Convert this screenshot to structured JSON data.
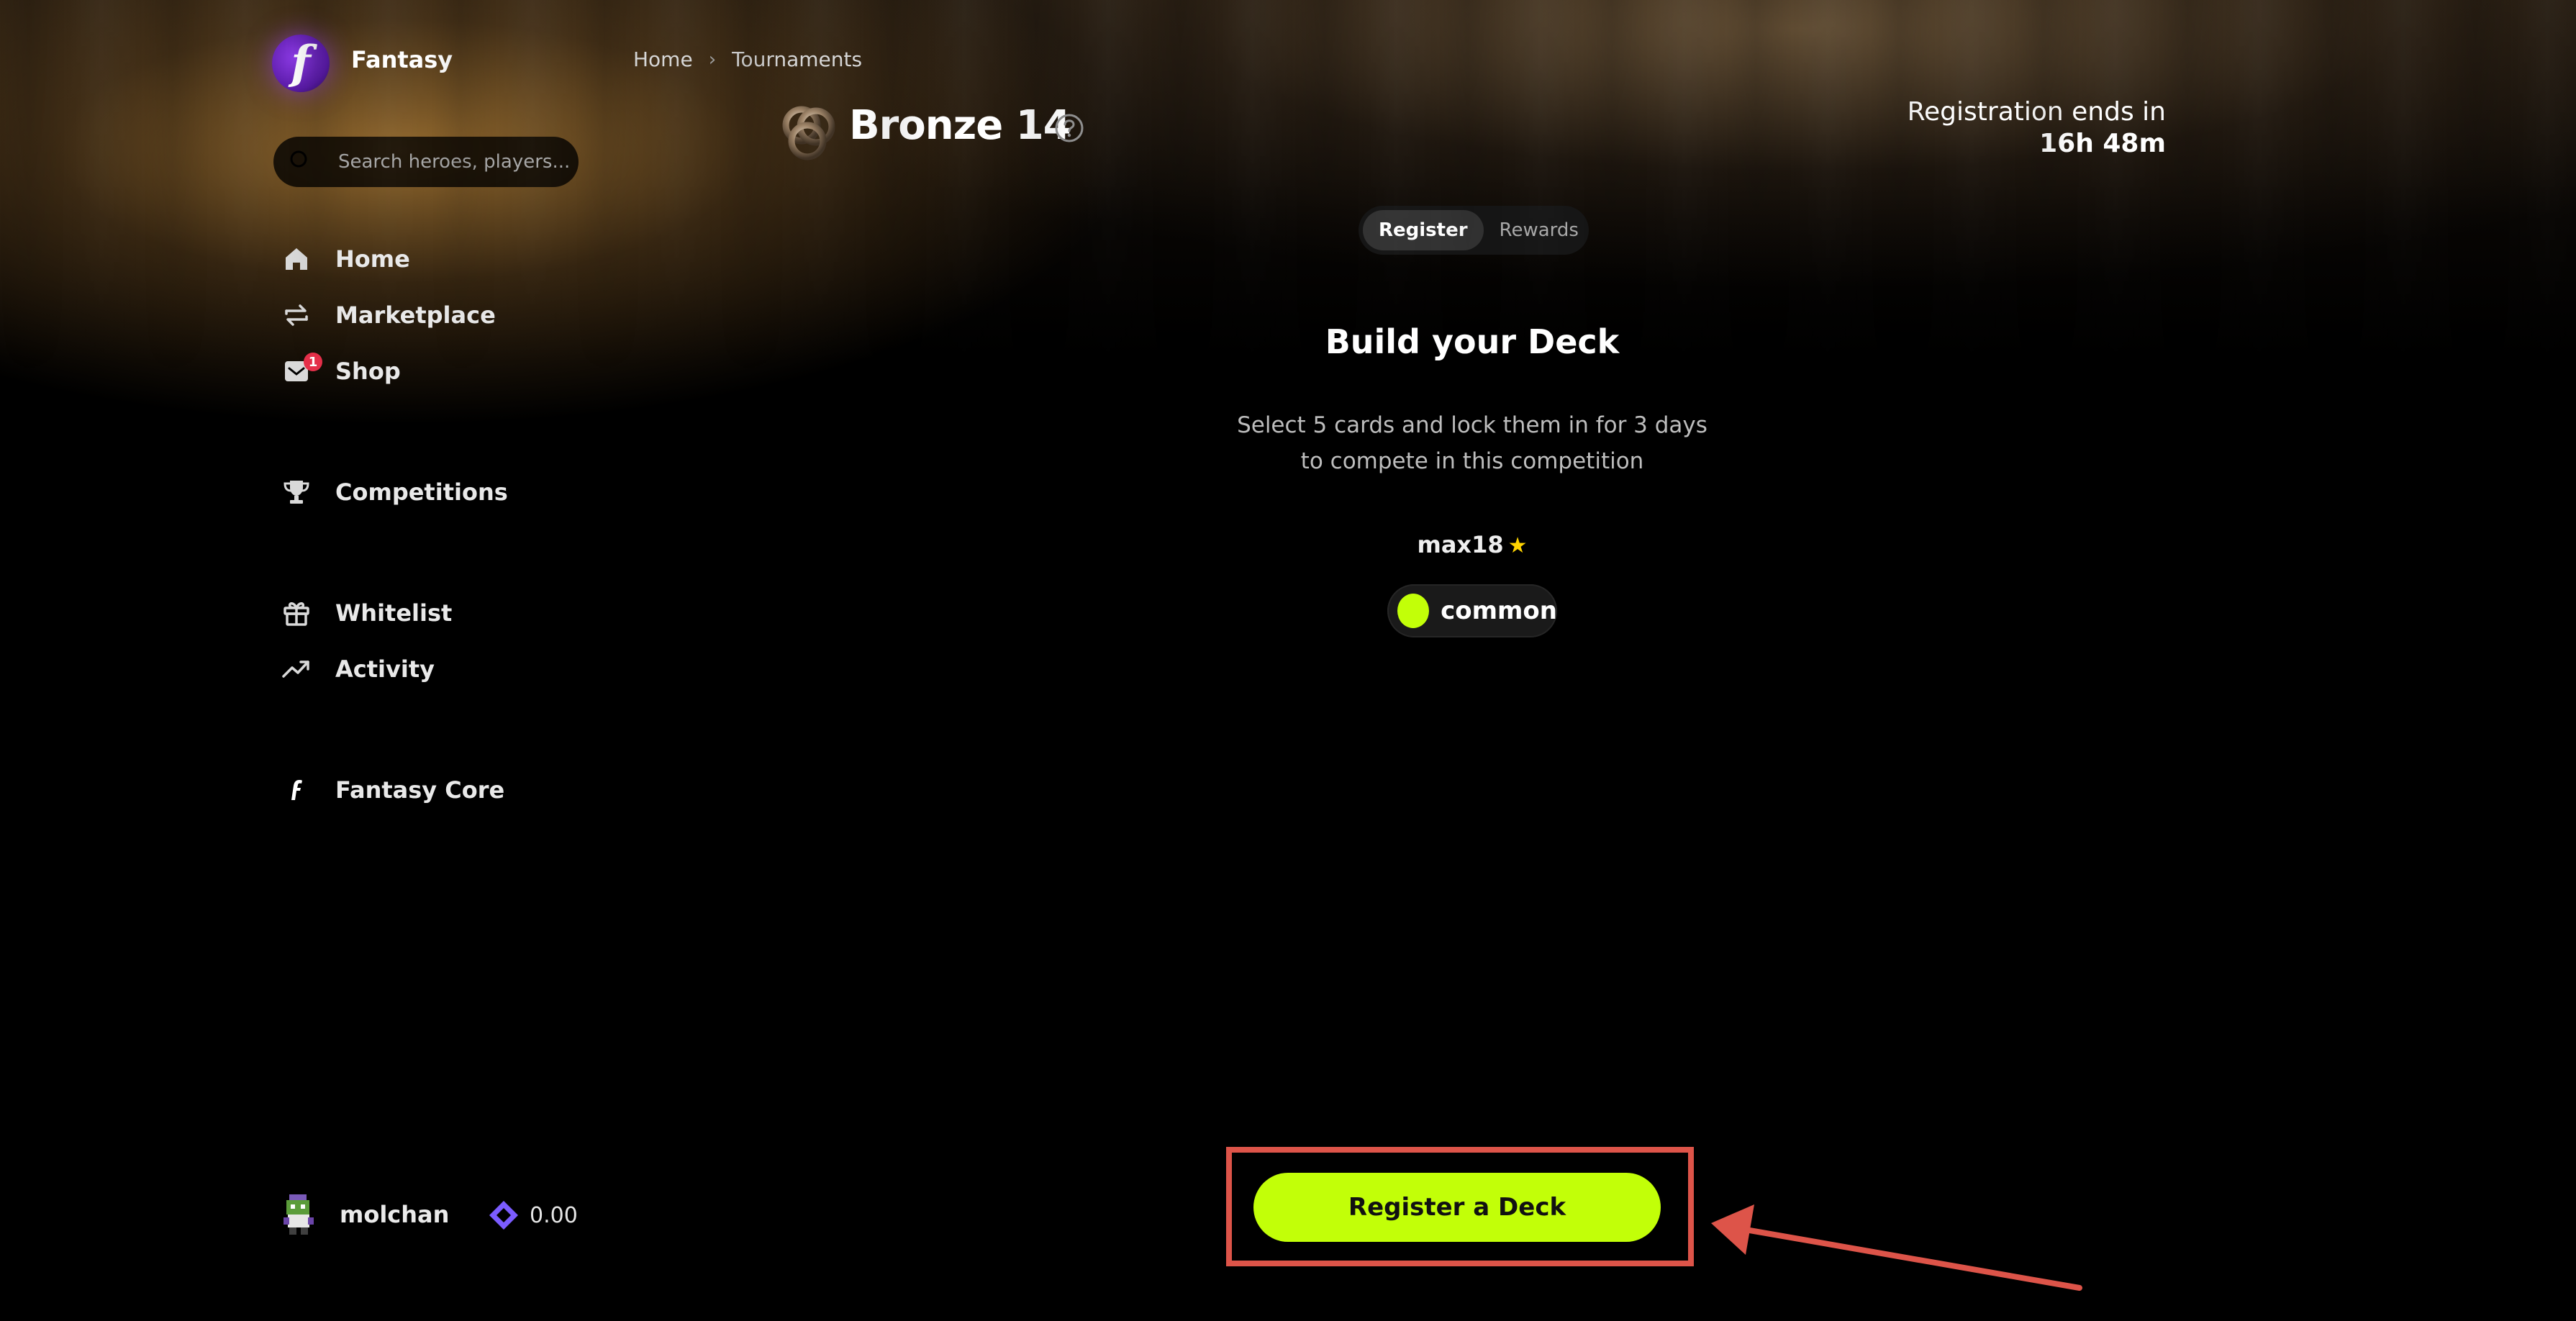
{
  "brand": {
    "name": "Fantasy",
    "logo_letter": "f"
  },
  "search": {
    "placeholder": "Search heroes, players..."
  },
  "sidebar": {
    "items": [
      {
        "label": "Home",
        "icon": "home-icon"
      },
      {
        "label": "Marketplace",
        "icon": "swap-arrows-icon"
      },
      {
        "label": "Shop",
        "icon": "shop-inbox-icon",
        "badge": "1"
      },
      {
        "label": "Competitions",
        "icon": "trophy-icon"
      },
      {
        "label": "Whitelist",
        "icon": "gift-icon"
      },
      {
        "label": "Activity",
        "icon": "trending-up-icon"
      },
      {
        "label": "Fantasy Core",
        "icon": "fantasy-core-icon"
      }
    ]
  },
  "user": {
    "name": "molchan",
    "balance": "0.00",
    "balance_icon": "diamond-icon"
  },
  "breadcrumb": {
    "home": "Home",
    "current": "Tournaments"
  },
  "tournament": {
    "title": "Bronze 14"
  },
  "registration": {
    "label": "Registration ends in",
    "time": "16h 48m"
  },
  "tabs": {
    "register": "Register",
    "rewards": "Rewards",
    "active": "Register"
  },
  "deck": {
    "title": "Build your Deck",
    "desc_line1": "Select 5 cards and lock them in for 3 days",
    "desc_line2": "to compete in this competition",
    "owner": "max18",
    "rarity": "common"
  },
  "actions": {
    "register_label": "Register a Deck"
  },
  "colors": {
    "accent": "#c2ff08",
    "highlight": "#dd5449",
    "badge": "#e5304a",
    "brand": "#6a22c0",
    "star": "#ffd400"
  }
}
